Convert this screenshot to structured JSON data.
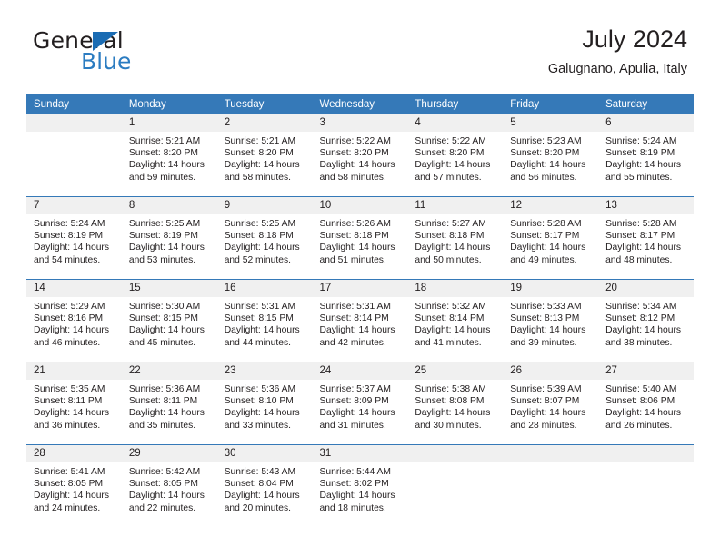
{
  "brand": {
    "word_general": "General",
    "word_blue": "Blue",
    "triangle_color": "#1b6cb3",
    "blue_color": "#2b7cc1"
  },
  "header": {
    "title": "July 2024",
    "location": "Galugnano, Apulia, Italy"
  },
  "theme": {
    "header_bg": "#3579b8",
    "daynum_bg": "#f0f0f0",
    "text_color": "#231f20"
  },
  "weekday_headers": [
    "Sunday",
    "Monday",
    "Tuesday",
    "Wednesday",
    "Thursday",
    "Friday",
    "Saturday"
  ],
  "weeks": [
    [
      {
        "day": "",
        "sunrise": "",
        "sunset": "",
        "daylight1": "",
        "daylight2": "",
        "empty": true
      },
      {
        "day": "1",
        "sunrise": "Sunrise: 5:21 AM",
        "sunset": "Sunset: 8:20 PM",
        "daylight1": "Daylight: 14 hours",
        "daylight2": "and 59 minutes."
      },
      {
        "day": "2",
        "sunrise": "Sunrise: 5:21 AM",
        "sunset": "Sunset: 8:20 PM",
        "daylight1": "Daylight: 14 hours",
        "daylight2": "and 58 minutes."
      },
      {
        "day": "3",
        "sunrise": "Sunrise: 5:22 AM",
        "sunset": "Sunset: 8:20 PM",
        "daylight1": "Daylight: 14 hours",
        "daylight2": "and 58 minutes."
      },
      {
        "day": "4",
        "sunrise": "Sunrise: 5:22 AM",
        "sunset": "Sunset: 8:20 PM",
        "daylight1": "Daylight: 14 hours",
        "daylight2": "and 57 minutes."
      },
      {
        "day": "5",
        "sunrise": "Sunrise: 5:23 AM",
        "sunset": "Sunset: 8:20 PM",
        "daylight1": "Daylight: 14 hours",
        "daylight2": "and 56 minutes."
      },
      {
        "day": "6",
        "sunrise": "Sunrise: 5:24 AM",
        "sunset": "Sunset: 8:19 PM",
        "daylight1": "Daylight: 14 hours",
        "daylight2": "and 55 minutes."
      }
    ],
    [
      {
        "day": "7",
        "sunrise": "Sunrise: 5:24 AM",
        "sunset": "Sunset: 8:19 PM",
        "daylight1": "Daylight: 14 hours",
        "daylight2": "and 54 minutes."
      },
      {
        "day": "8",
        "sunrise": "Sunrise: 5:25 AM",
        "sunset": "Sunset: 8:19 PM",
        "daylight1": "Daylight: 14 hours",
        "daylight2": "and 53 minutes."
      },
      {
        "day": "9",
        "sunrise": "Sunrise: 5:25 AM",
        "sunset": "Sunset: 8:18 PM",
        "daylight1": "Daylight: 14 hours",
        "daylight2": "and 52 minutes."
      },
      {
        "day": "10",
        "sunrise": "Sunrise: 5:26 AM",
        "sunset": "Sunset: 8:18 PM",
        "daylight1": "Daylight: 14 hours",
        "daylight2": "and 51 minutes."
      },
      {
        "day": "11",
        "sunrise": "Sunrise: 5:27 AM",
        "sunset": "Sunset: 8:18 PM",
        "daylight1": "Daylight: 14 hours",
        "daylight2": "and 50 minutes."
      },
      {
        "day": "12",
        "sunrise": "Sunrise: 5:28 AM",
        "sunset": "Sunset: 8:17 PM",
        "daylight1": "Daylight: 14 hours",
        "daylight2": "and 49 minutes."
      },
      {
        "day": "13",
        "sunrise": "Sunrise: 5:28 AM",
        "sunset": "Sunset: 8:17 PM",
        "daylight1": "Daylight: 14 hours",
        "daylight2": "and 48 minutes."
      }
    ],
    [
      {
        "day": "14",
        "sunrise": "Sunrise: 5:29 AM",
        "sunset": "Sunset: 8:16 PM",
        "daylight1": "Daylight: 14 hours",
        "daylight2": "and 46 minutes."
      },
      {
        "day": "15",
        "sunrise": "Sunrise: 5:30 AM",
        "sunset": "Sunset: 8:15 PM",
        "daylight1": "Daylight: 14 hours",
        "daylight2": "and 45 minutes."
      },
      {
        "day": "16",
        "sunrise": "Sunrise: 5:31 AM",
        "sunset": "Sunset: 8:15 PM",
        "daylight1": "Daylight: 14 hours",
        "daylight2": "and 44 minutes."
      },
      {
        "day": "17",
        "sunrise": "Sunrise: 5:31 AM",
        "sunset": "Sunset: 8:14 PM",
        "daylight1": "Daylight: 14 hours",
        "daylight2": "and 42 minutes."
      },
      {
        "day": "18",
        "sunrise": "Sunrise: 5:32 AM",
        "sunset": "Sunset: 8:14 PM",
        "daylight1": "Daylight: 14 hours",
        "daylight2": "and 41 minutes."
      },
      {
        "day": "19",
        "sunrise": "Sunrise: 5:33 AM",
        "sunset": "Sunset: 8:13 PM",
        "daylight1": "Daylight: 14 hours",
        "daylight2": "and 39 minutes."
      },
      {
        "day": "20",
        "sunrise": "Sunrise: 5:34 AM",
        "sunset": "Sunset: 8:12 PM",
        "daylight1": "Daylight: 14 hours",
        "daylight2": "and 38 minutes."
      }
    ],
    [
      {
        "day": "21",
        "sunrise": "Sunrise: 5:35 AM",
        "sunset": "Sunset: 8:11 PM",
        "daylight1": "Daylight: 14 hours",
        "daylight2": "and 36 minutes."
      },
      {
        "day": "22",
        "sunrise": "Sunrise: 5:36 AM",
        "sunset": "Sunset: 8:11 PM",
        "daylight1": "Daylight: 14 hours",
        "daylight2": "and 35 minutes."
      },
      {
        "day": "23",
        "sunrise": "Sunrise: 5:36 AM",
        "sunset": "Sunset: 8:10 PM",
        "daylight1": "Daylight: 14 hours",
        "daylight2": "and 33 minutes."
      },
      {
        "day": "24",
        "sunrise": "Sunrise: 5:37 AM",
        "sunset": "Sunset: 8:09 PM",
        "daylight1": "Daylight: 14 hours",
        "daylight2": "and 31 minutes."
      },
      {
        "day": "25",
        "sunrise": "Sunrise: 5:38 AM",
        "sunset": "Sunset: 8:08 PM",
        "daylight1": "Daylight: 14 hours",
        "daylight2": "and 30 minutes."
      },
      {
        "day": "26",
        "sunrise": "Sunrise: 5:39 AM",
        "sunset": "Sunset: 8:07 PM",
        "daylight1": "Daylight: 14 hours",
        "daylight2": "and 28 minutes."
      },
      {
        "day": "27",
        "sunrise": "Sunrise: 5:40 AM",
        "sunset": "Sunset: 8:06 PM",
        "daylight1": "Daylight: 14 hours",
        "daylight2": "and 26 minutes."
      }
    ],
    [
      {
        "day": "28",
        "sunrise": "Sunrise: 5:41 AM",
        "sunset": "Sunset: 8:05 PM",
        "daylight1": "Daylight: 14 hours",
        "daylight2": "and 24 minutes."
      },
      {
        "day": "29",
        "sunrise": "Sunrise: 5:42 AM",
        "sunset": "Sunset: 8:05 PM",
        "daylight1": "Daylight: 14 hours",
        "daylight2": "and 22 minutes."
      },
      {
        "day": "30",
        "sunrise": "Sunrise: 5:43 AM",
        "sunset": "Sunset: 8:04 PM",
        "daylight1": "Daylight: 14 hours",
        "daylight2": "and 20 minutes."
      },
      {
        "day": "31",
        "sunrise": "Sunrise: 5:44 AM",
        "sunset": "Sunset: 8:02 PM",
        "daylight1": "Daylight: 14 hours",
        "daylight2": "and 18 minutes."
      },
      {
        "day": "",
        "sunrise": "",
        "sunset": "",
        "daylight1": "",
        "daylight2": "",
        "empty": true
      },
      {
        "day": "",
        "sunrise": "",
        "sunset": "",
        "daylight1": "",
        "daylight2": "",
        "empty": true
      },
      {
        "day": "",
        "sunrise": "",
        "sunset": "",
        "daylight1": "",
        "daylight2": "",
        "empty": true
      }
    ]
  ]
}
